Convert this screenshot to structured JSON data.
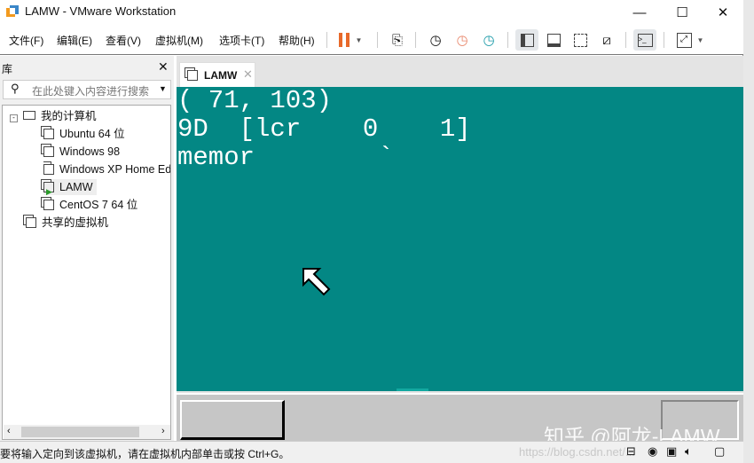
{
  "window": {
    "title": "LAMW - VMware Workstation",
    "controls": [
      "minimize",
      "maximize",
      "close"
    ]
  },
  "menu": [
    "文件(F)",
    "编辑(E)",
    "查看(V)",
    "虚拟机(M)",
    "选项卡(T)",
    "帮助(H)"
  ],
  "toolbar": {
    "icons": [
      "pause-icon",
      "send-keys-icon",
      "snapshot-take-icon",
      "snapshot-revert-icon",
      "snapshot-manager-icon",
      "library-view-icon",
      "thumbnail-bar-icon",
      "fullscreen-icon",
      "unity-icon",
      "console-icon",
      "stretch-icon"
    ],
    "accent": "#e8692a"
  },
  "library": {
    "title": "库",
    "search_placeholder": "在此处键入内容进行搜索",
    "root": "我的计算机",
    "vms": [
      "Ubuntu 64 位",
      "Windows 98",
      "Windows XP Home Ed",
      "LAMW",
      "CentOS 7 64 位"
    ],
    "selected": "LAMW",
    "shared": "共享的虚拟机"
  },
  "tab": {
    "label": "LAMW"
  },
  "screen": {
    "lines": [
      "( 71, 103)",
      "9D  [lcr    0    1]",
      "memor        `"
    ],
    "bg": "#038784"
  },
  "status": {
    "text": "要将输入定向到该虚拟机，请在虚拟机内部单击或按 Ctrl+G。"
  },
  "watermark": {
    "zhihu": "知乎 @阿龙-LAMW",
    "csdn": "https://blog.csdn.net/..."
  }
}
